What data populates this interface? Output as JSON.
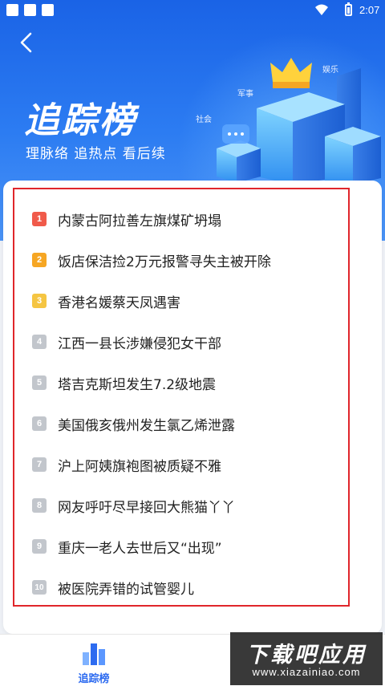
{
  "status_bar": {
    "time": "2:07"
  },
  "header": {
    "title": "追踪榜",
    "subtitle": "理脉络 追热点 看后续",
    "tags": [
      "娱乐",
      "军事",
      "社会"
    ]
  },
  "colors": {
    "brand": "#2c7cf2",
    "rank_1": "#f05a4a",
    "rank_2": "#f6a623",
    "rank_3": "#f5c542",
    "rank_other": "#c2c6cc",
    "highlight": "#e0262b"
  },
  "list": {
    "items": [
      {
        "rank": "1",
        "title": "内蒙古阿拉善左旗煤矿坍塌"
      },
      {
        "rank": "2",
        "title": "饭店保洁捡2万元报警寻失主被开除"
      },
      {
        "rank": "3",
        "title": "香港名媛蔡天凤遇害"
      },
      {
        "rank": "4",
        "title": "江西一县长涉嫌侵犯女干部"
      },
      {
        "rank": "5",
        "title": "塔吉克斯坦发生7.2级地震"
      },
      {
        "rank": "6",
        "title": "美国俄亥俄州发生氯乙烯泄露"
      },
      {
        "rank": "7",
        "title": "沪上阿姨旗袍图被质疑不雅"
      },
      {
        "rank": "8",
        "title": "网友呼吁尽早接回大熊猫丫丫"
      },
      {
        "rank": "9",
        "title": "重庆一老人去世后又“出现”"
      },
      {
        "rank": "10",
        "title": "被医院弄错的试管婴儿"
      }
    ]
  },
  "tabbar": {
    "tab_label": "追踪榜"
  },
  "watermark": {
    "line1": "下载吧应用",
    "line2": "www.xiazainiao.com"
  }
}
